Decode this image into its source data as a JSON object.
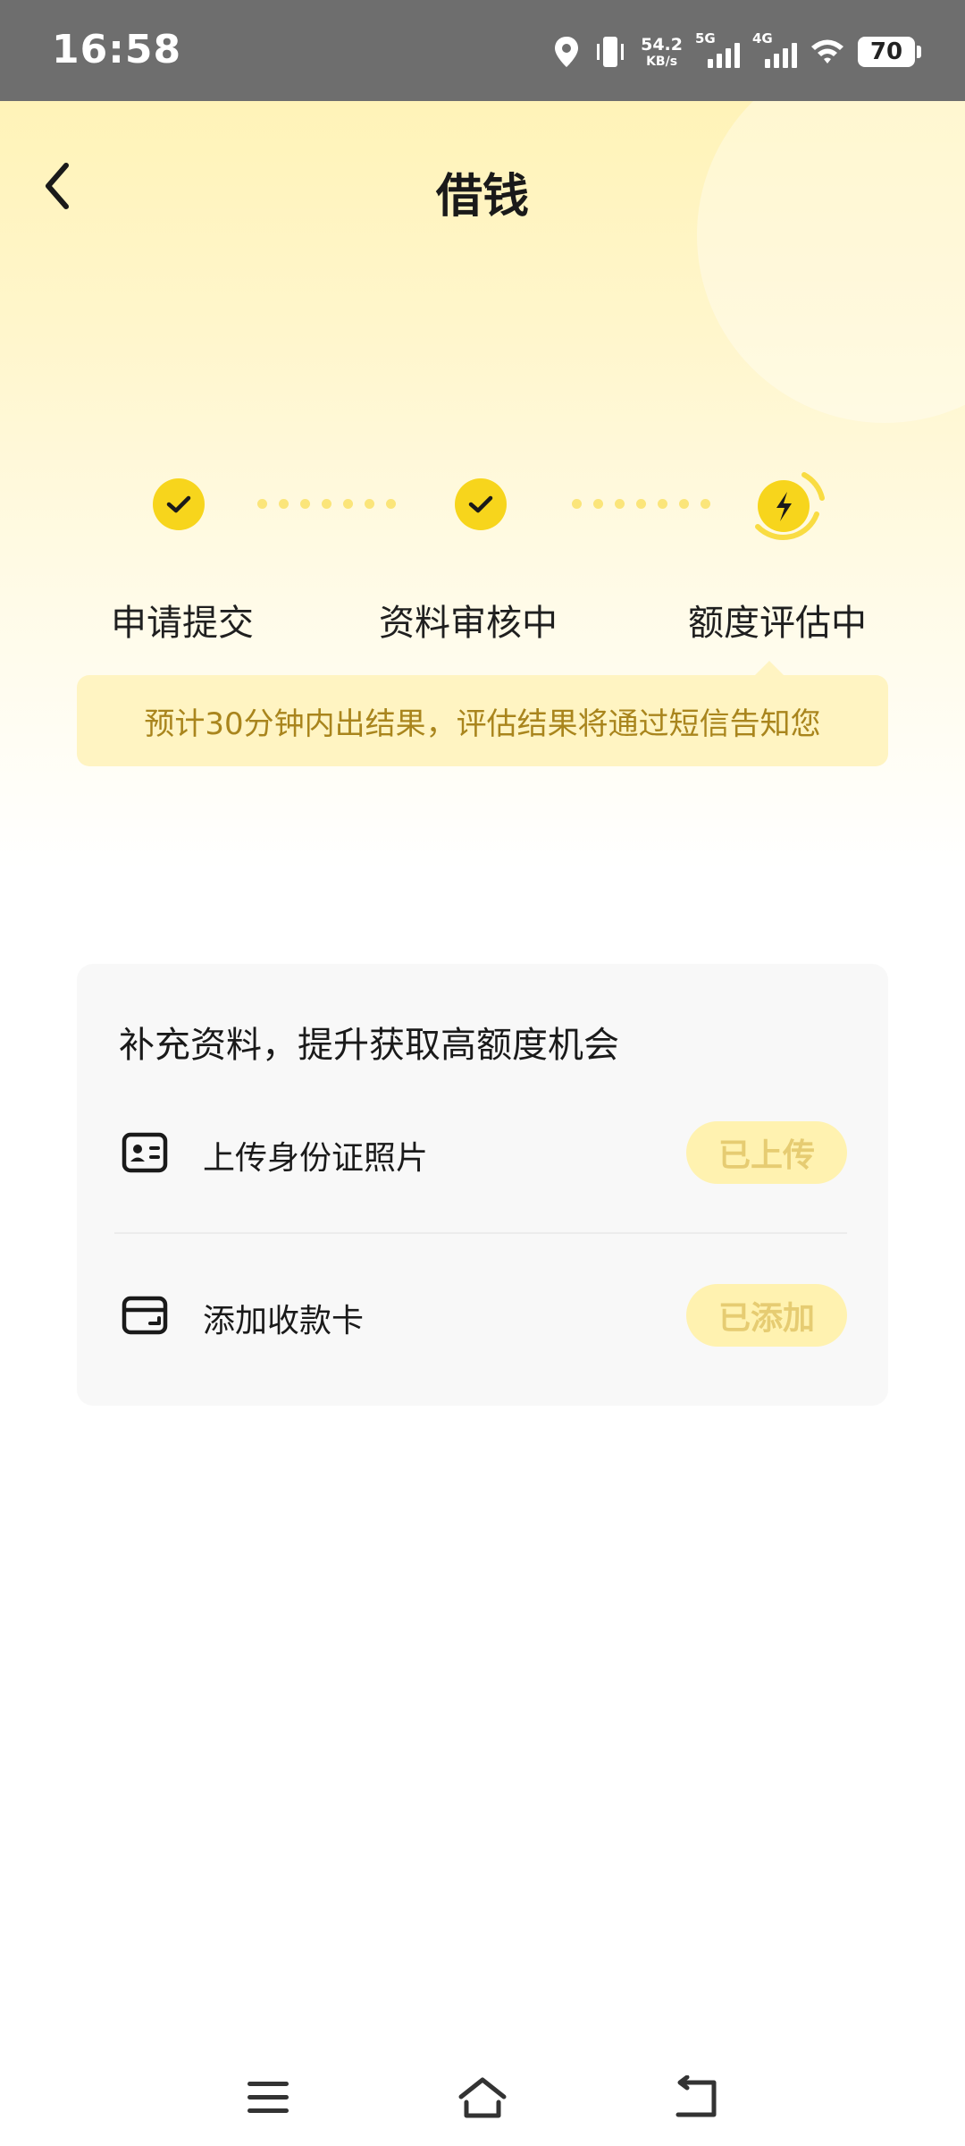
{
  "status_bar": {
    "time": "16:58",
    "net_speed_value": "54.2",
    "net_speed_unit": "KB/s",
    "signal1_label": "5G",
    "signal2_label": "4G",
    "battery": "70"
  },
  "header": {
    "title": "借钱"
  },
  "progress": {
    "steps": [
      {
        "label": "申请提交",
        "status": "done"
      },
      {
        "label": "资料审核中",
        "status": "done"
      },
      {
        "label": "额度评估中",
        "status": "active"
      }
    ],
    "tip": "预计30分钟内出结果，评估结果将通过短信告知您"
  },
  "supplement": {
    "title": "补充资料，提升获取高额度机会",
    "items": [
      {
        "label": "上传身份证照片",
        "button": "已上传",
        "icon": "id-card-icon"
      },
      {
        "label": "添加收款卡",
        "button": "已添加",
        "icon": "wallet-card-icon"
      }
    ]
  },
  "colors": {
    "accent": "#f7d51c",
    "tip_text": "#a9851d",
    "tip_bg": "#fff4c2",
    "disabled_btn_bg": "#fff2b0",
    "disabled_btn_text": "#e6cc72"
  }
}
